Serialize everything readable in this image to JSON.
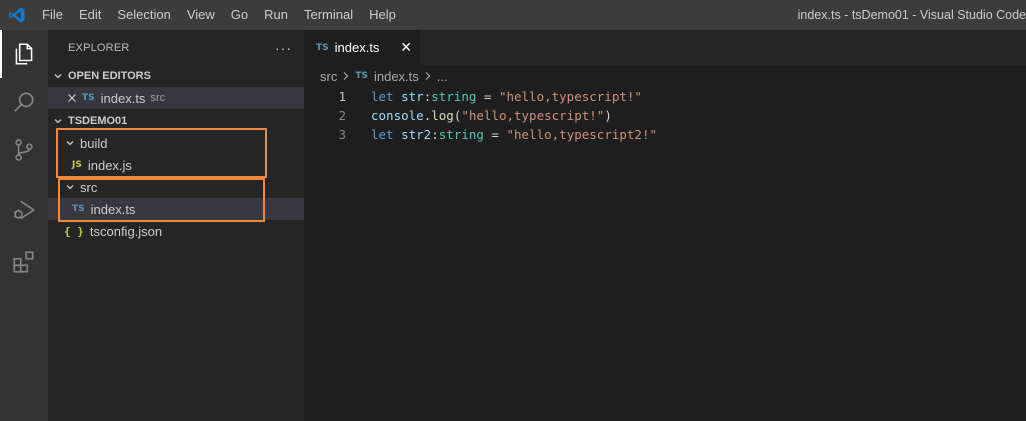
{
  "titlebar": {
    "menu": [
      "File",
      "Edit",
      "Selection",
      "View",
      "Go",
      "Run",
      "Terminal",
      "Help"
    ],
    "window_title": "index.ts - tsDemo01 - Visual Studio Code"
  },
  "sidebar": {
    "header": "EXPLORER",
    "more": "···",
    "open_editors": {
      "title": "OPEN EDITORS",
      "items": [
        {
          "badge": "TS",
          "name": "index.ts",
          "dir": "src"
        }
      ]
    },
    "workspace": {
      "title": "TSDEMO01",
      "build_folder": "build",
      "build_file": {
        "badge": "JS",
        "name": "index.js"
      },
      "src_folder": "src",
      "src_file": {
        "badge": "TS",
        "name": "index.ts"
      },
      "config_file": {
        "badge": "{ }",
        "name": "tsconfig.json"
      }
    }
  },
  "editor": {
    "tab": {
      "badge": "TS",
      "label": "index.ts",
      "close": "✕"
    },
    "breadcrumb": {
      "folder": "src",
      "badge": "TS",
      "file": "index.ts",
      "more": "..."
    },
    "lines": [
      {
        "number": "1"
      },
      {
        "number": "2"
      },
      {
        "number": "3"
      }
    ],
    "code": {
      "l1": {
        "kw": "let",
        "name": " str",
        "colon": ":",
        "type": "string",
        "eq": " = ",
        "str": "\"hello,typescript!\""
      },
      "l2": {
        "obj": "console",
        "dot": ".",
        "fn": "log",
        "open": "(",
        "str": "\"hello,typescript!\"",
        "close": ")"
      },
      "l3": {
        "kw": "let",
        "name": " str2",
        "colon": ":",
        "type": "string",
        "eq": " = ",
        "str": "\"hello,typescript2!\""
      }
    }
  },
  "colors": {
    "highlight_box": "#f0883e",
    "ts_badge": "#519aba",
    "js_badge": "#cbcb41"
  },
  "icons": [
    "vscode-logo-icon",
    "explorer-icon",
    "search-icon",
    "source-control-icon",
    "run-debug-icon",
    "extensions-icon"
  ]
}
